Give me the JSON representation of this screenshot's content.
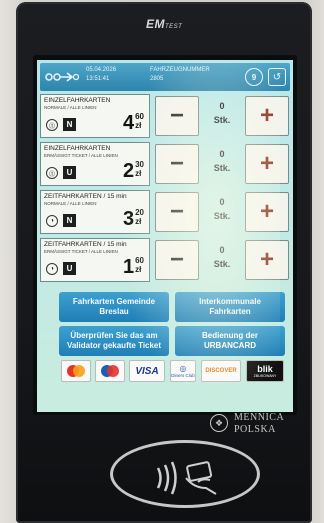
{
  "device": {
    "brand": "EM",
    "brand_suffix": "TEST",
    "maker_logo_line1": "MENNICA",
    "maker_logo_line2": "POLSKA"
  },
  "header": {
    "date": "05.04.2026",
    "time": "13:51:41",
    "vehicle_label": "FAHRZEUGNUMMER",
    "vehicle_number": "2805",
    "info_button_label": "9",
    "back_icon": "back-arrow-icon"
  },
  "tickets": [
    {
      "name": "EINZELFAHRKARTEN",
      "sub": "NORMALE / ALLE LINIEN",
      "zone": "⓵",
      "type": "N",
      "price_main": "4",
      "price_cents": "60",
      "currency": "zł",
      "qty": "0",
      "unit": "Stk."
    },
    {
      "name": "EINZELFAHRKARTEN",
      "sub": "ERMÄSSIGT TICKET / ALLE LINIEN",
      "zone": "⓵",
      "type": "U",
      "price_main": "2",
      "price_cents": "30",
      "currency": "zł",
      "qty": "0",
      "unit": "Stk."
    },
    {
      "name": "ZEITFAHRKARTEN / 15 min",
      "sub": "NORMALE / ALLE LINIEN",
      "zone": "◑",
      "type": "N",
      "price_main": "3",
      "price_cents": "20",
      "currency": "zł",
      "qty": "0",
      "unit": "Stk."
    },
    {
      "name": "ZEITFAHRKARTEN / 15 min",
      "sub": "ERMÄSSIGT TICKET / ALLE LINIEN",
      "zone": "◑",
      "type": "U",
      "price_main": "1",
      "price_cents": "60",
      "currency": "zł",
      "qty": "0",
      "unit": "Stk."
    }
  ],
  "controls": {
    "minus": "−",
    "plus": "+"
  },
  "menu_buttons": {
    "breslau": "Fahrkarten Gemeinde Breslau",
    "interkommunale": "Interkommunale Fahrkarten",
    "validator": "Überprüfen Sie das am Validator gekaufte Ticket",
    "urbancard": "Bedienung der URBANCARD"
  },
  "payment_logos": [
    "mastercard",
    "maestro",
    "VISA",
    "Diners Club",
    "DISCOVER",
    "blik"
  ],
  "payment_logo_text": {
    "visa": "VISA",
    "diners": "Diners Club",
    "discover": "DISCOVER",
    "blik": "blik",
    "blik_sub": "ZBLIKOWANY"
  },
  "colors": {
    "screen_bg": "#bfe9e6",
    "topbar": "#2d84ad",
    "button_blue": "#1f7fb6",
    "plus_red": "#8b2f1c"
  }
}
